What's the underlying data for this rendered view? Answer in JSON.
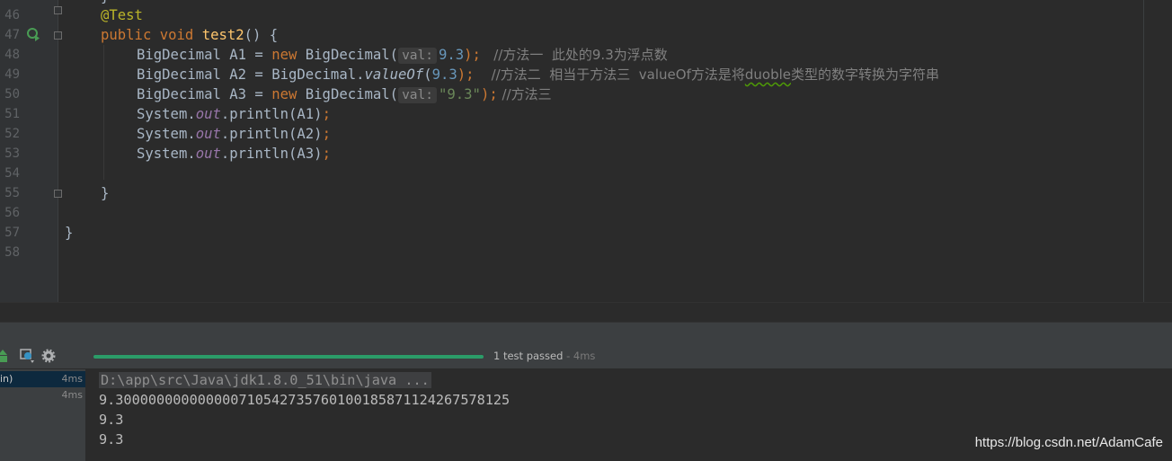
{
  "editor": {
    "line_numbers": [
      "46",
      "47",
      "48",
      "49",
      "50",
      "51",
      "52",
      "53",
      "54",
      "55",
      "56",
      "57",
      "58"
    ],
    "lines": {
      "l46": {
        "annotation": "@Test"
      },
      "l47": {
        "kw_public": "public",
        "kw_void": "void",
        "method": "test2",
        "rest": "() {"
      },
      "l48": {
        "pre": "BigDecimal A1 = ",
        "kw_new": "new",
        "ctor": " BigDecimal(",
        "hint": "val:",
        "num": "9.3",
        "end": ");",
        "comment": "   //方法一  此处的9.3为浮点数"
      },
      "l49": {
        "pre": "BigDecimal A2 = BigDecimal.",
        "method": "valueOf",
        "open": "(",
        "num": "9.3",
        "end": ");",
        "comment_a": "    //方法二  相当于方法三  valueOf方法是将",
        "comment_sq": "duoble",
        "comment_b": "类型的数字转换为字符串"
      },
      "l50": {
        "pre": "BigDecimal A3 = ",
        "kw_new": "new",
        "ctor": " BigDecimal(",
        "hint": "val:",
        "str": "\"9.3\"",
        "end": ");",
        "comment": " //方法三"
      },
      "l51": {
        "a": "System.",
        "field": "out",
        "b": ".println(A1)",
        "semi": ";"
      },
      "l52": {
        "a": "System.",
        "field": "out",
        "b": ".println(A2)",
        "semi": ";"
      },
      "l53": {
        "a": "System.",
        "field": "out",
        "b": ".println(A3)",
        "semi": ";"
      },
      "l55": {
        "text": "}"
      },
      "l57": {
        "text": "}"
      }
    }
  },
  "run_panel": {
    "status": "1 test passed",
    "status_time": " - 4ms",
    "progress": 1.0,
    "icons": [
      "rerun-icon",
      "export-icon",
      "settings-icon"
    ]
  },
  "test_tree": {
    "rows": [
      {
        "label": "in)",
        "time": "4ms",
        "selected": true
      },
      {
        "label": "",
        "time": "4ms",
        "selected": false
      }
    ]
  },
  "console": {
    "command": "D:\\app\\src\\Java\\jdk1.8.0_51\\bin\\java ...",
    "output": [
      "9.300000000000000710542735760100185871124267578125",
      "9.3",
      "9.3"
    ]
  },
  "watermark": "https://blog.csdn.net/AdamCafe",
  "colors": {
    "background": "#2b2b2b",
    "keyword": "#cc7832",
    "annotation": "#bbb529",
    "method": "#ffc66d",
    "number": "#6897bb",
    "string": "#6a8759",
    "static_field": "#9876aa",
    "comment": "#808080",
    "progress": "#2b9c68"
  }
}
